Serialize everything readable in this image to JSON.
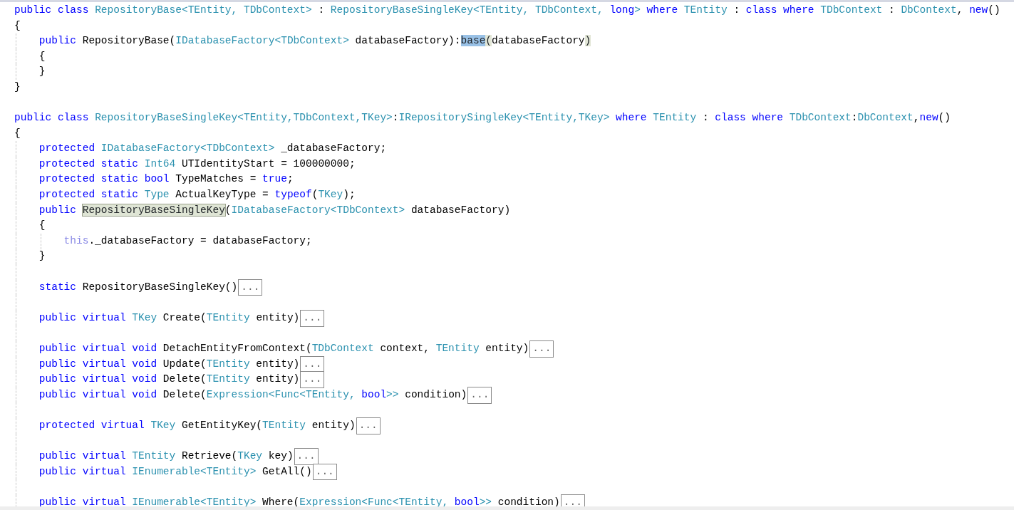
{
  "editor": {
    "lines": [
      {
        "kind": "code",
        "tokens": [
          {
            "text": "public class ",
            "kind": "keyword"
          },
          {
            "text": "RepositoryBase<TEntity, TDbContext>",
            "kind": "type"
          },
          {
            "text": " : ",
            "kind": "plain"
          },
          {
            "text": "RepositoryBaseSingleKey<TEntity, TDbContext, ",
            "kind": "type"
          },
          {
            "text": "long",
            "kind": "keyword"
          },
          {
            "text": ">",
            "kind": "type"
          },
          {
            "text": " where ",
            "kind": "keyword"
          },
          {
            "text": "TEntity",
            "kind": "type"
          },
          {
            "text": " : ",
            "kind": "plain"
          },
          {
            "text": "class where ",
            "kind": "keyword"
          },
          {
            "text": "TDbContext",
            "kind": "type"
          },
          {
            "text": " : ",
            "kind": "plain"
          },
          {
            "text": "DbContext",
            "kind": "type"
          },
          {
            "text": ", ",
            "kind": "plain"
          },
          {
            "text": "new",
            "kind": "keyword"
          },
          {
            "text": "()",
            "kind": "plain"
          }
        ]
      },
      {
        "kind": "code",
        "tokens": [
          {
            "text": "{",
            "kind": "plain"
          }
        ],
        "children": [
          {
            "kind": "code",
            "tokens": [
              {
                "text": "public ",
                "kind": "keyword"
              },
              {
                "text": "RepositoryBase(",
                "kind": "plain"
              },
              {
                "text": "IDatabaseFactory<TDbContext>",
                "kind": "type"
              },
              {
                "text": " databaseFactory):",
                "kind": "plain"
              },
              {
                "text": "base",
                "kind": "selection"
              },
              {
                "text": "(",
                "kind": "brace_match"
              },
              {
                "text": "databaseFactory",
                "kind": "plain"
              },
              {
                "text": ")",
                "kind": "brace_match"
              }
            ]
          },
          {
            "kind": "code",
            "tokens": [
              {
                "text": "{",
                "kind": "plain"
              }
            ]
          },
          {
            "kind": "code",
            "tokens": [
              {
                "text": "}",
                "kind": "plain"
              }
            ]
          }
        ]
      },
      {
        "kind": "code",
        "tokens": [
          {
            "text": "}",
            "kind": "plain"
          }
        ]
      },
      {
        "kind": "blank"
      },
      {
        "kind": "code",
        "tokens": [
          {
            "text": "public class ",
            "kind": "keyword"
          },
          {
            "text": "RepositoryBaseSingleKey<TEntity,TDbContext,TKey>",
            "kind": "type"
          },
          {
            "text": ":",
            "kind": "plain"
          },
          {
            "text": "IRepositorySingleKey<TEntity,TKey>",
            "kind": "type"
          },
          {
            "text": " where ",
            "kind": "keyword"
          },
          {
            "text": "TEntity",
            "kind": "type"
          },
          {
            "text": " : ",
            "kind": "plain"
          },
          {
            "text": "class where ",
            "kind": "keyword"
          },
          {
            "text": "TDbContext",
            "kind": "type"
          },
          {
            "text": ":",
            "kind": "plain"
          },
          {
            "text": "DbContext",
            "kind": "type"
          },
          {
            "text": ",",
            "kind": "plain"
          },
          {
            "text": "new",
            "kind": "keyword"
          },
          {
            "text": "()",
            "kind": "plain"
          }
        ]
      },
      {
        "kind": "code",
        "tokens": [
          {
            "text": "{",
            "kind": "plain"
          }
        ],
        "children": [
          {
            "kind": "code",
            "tokens": [
              {
                "text": "protected ",
                "kind": "keyword"
              },
              {
                "text": "IDatabaseFactory<TDbContext>",
                "kind": "type"
              },
              {
                "text": " _databaseFactory;",
                "kind": "plain"
              }
            ]
          },
          {
            "kind": "code",
            "tokens": [
              {
                "text": "protected static ",
                "kind": "keyword"
              },
              {
                "text": "Int64",
                "kind": "type"
              },
              {
                "text": " UTIdentityStart = 100000000;",
                "kind": "plain"
              }
            ]
          },
          {
            "kind": "code",
            "tokens": [
              {
                "text": "protected static bool",
                "kind": "keyword"
              },
              {
                "text": " TypeMatches = ",
                "kind": "plain"
              },
              {
                "text": "true",
                "kind": "keyword"
              },
              {
                "text": ";",
                "kind": "plain"
              }
            ]
          },
          {
            "kind": "code",
            "tokens": [
              {
                "text": "protected static ",
                "kind": "keyword"
              },
              {
                "text": "Type",
                "kind": "type"
              },
              {
                "text": " ActualKeyType = ",
                "kind": "plain"
              },
              {
                "text": "typeof",
                "kind": "keyword"
              },
              {
                "text": "(",
                "kind": "plain"
              },
              {
                "text": "TKey",
                "kind": "type"
              },
              {
                "text": ");",
                "kind": "plain"
              }
            ]
          },
          {
            "kind": "code",
            "tokens": [
              {
                "text": "public ",
                "kind": "keyword"
              },
              {
                "text": "RepositoryBaseSingleKey",
                "kind": "reference"
              },
              {
                "text": "(",
                "kind": "plain"
              },
              {
                "text": "IDatabaseFactory<TDbContext>",
                "kind": "type"
              },
              {
                "text": " databaseFactory)",
                "kind": "plain"
              }
            ]
          },
          {
            "kind": "code",
            "tokens": [
              {
                "text": "{",
                "kind": "plain"
              }
            ],
            "children": [
              {
                "kind": "code",
                "tokens": [
                  {
                    "text": "this",
                    "kind": "this"
                  },
                  {
                    "text": "._databaseFactory = databaseFactory;",
                    "kind": "plain"
                  }
                ]
              }
            ]
          },
          {
            "kind": "code",
            "tokens": [
              {
                "text": "}",
                "kind": "plain"
              }
            ]
          },
          {
            "kind": "blank"
          },
          {
            "kind": "code",
            "tokens": [
              {
                "text": "static ",
                "kind": "keyword"
              },
              {
                "text": "RepositoryBaseSingleKey()",
                "kind": "plain"
              }
            ],
            "fold": "..."
          },
          {
            "kind": "blank"
          },
          {
            "kind": "code",
            "tokens": [
              {
                "text": "public virtual ",
                "kind": "keyword"
              },
              {
                "text": "TKey",
                "kind": "type"
              },
              {
                "text": " Create(",
                "kind": "plain"
              },
              {
                "text": "TEntity",
                "kind": "type"
              },
              {
                "text": " entity)",
                "kind": "plain"
              }
            ],
            "fold": "..."
          },
          {
            "kind": "blank"
          },
          {
            "kind": "code",
            "tokens": [
              {
                "text": "public virtual void ",
                "kind": "keyword"
              },
              {
                "text": "DetachEntityFromContext(",
                "kind": "plain"
              },
              {
                "text": "TDbContext",
                "kind": "type"
              },
              {
                "text": " context, ",
                "kind": "plain"
              },
              {
                "text": "TEntity",
                "kind": "type"
              },
              {
                "text": " entity)",
                "kind": "plain"
              }
            ],
            "fold": "..."
          },
          {
            "kind": "code",
            "tokens": [
              {
                "text": "public virtual void ",
                "kind": "keyword"
              },
              {
                "text": "Update(",
                "kind": "plain"
              },
              {
                "text": "TEntity",
                "kind": "type"
              },
              {
                "text": " entity)",
                "kind": "plain"
              }
            ],
            "fold": "..."
          },
          {
            "kind": "code",
            "tokens": [
              {
                "text": "public virtual void ",
                "kind": "keyword"
              },
              {
                "text": "Delete(",
                "kind": "plain"
              },
              {
                "text": "TEntity",
                "kind": "type"
              },
              {
                "text": " entity)",
                "kind": "plain"
              }
            ],
            "fold": "..."
          },
          {
            "kind": "code",
            "tokens": [
              {
                "text": "public virtual void ",
                "kind": "keyword"
              },
              {
                "text": "Delete(",
                "kind": "plain"
              },
              {
                "text": "Expression<Func<TEntity, ",
                "kind": "type"
              },
              {
                "text": "bool",
                "kind": "keyword"
              },
              {
                "text": ">>",
                "kind": "type"
              },
              {
                "text": " condition)",
                "kind": "plain"
              }
            ],
            "fold": "..."
          },
          {
            "kind": "blank"
          },
          {
            "kind": "code",
            "tokens": [
              {
                "text": "protected virtual ",
                "kind": "keyword"
              },
              {
                "text": "TKey",
                "kind": "type"
              },
              {
                "text": " GetEntityKey(",
                "kind": "plain"
              },
              {
                "text": "TEntity",
                "kind": "type"
              },
              {
                "text": " entity)",
                "kind": "plain"
              }
            ],
            "fold": "..."
          },
          {
            "kind": "blank"
          },
          {
            "kind": "code",
            "tokens": [
              {
                "text": "public virtual ",
                "kind": "keyword"
              },
              {
                "text": "TEntity",
                "kind": "type"
              },
              {
                "text": " Retrieve(",
                "kind": "plain"
              },
              {
                "text": "TKey",
                "kind": "type"
              },
              {
                "text": " key)",
                "kind": "plain"
              }
            ],
            "fold": "..."
          },
          {
            "kind": "code",
            "tokens": [
              {
                "text": "public virtual ",
                "kind": "keyword"
              },
              {
                "text": "IEnumerable<TEntity>",
                "kind": "type"
              },
              {
                "text": " GetAll()",
                "kind": "plain"
              }
            ],
            "fold": "..."
          },
          {
            "kind": "blank"
          },
          {
            "kind": "code",
            "tokens": [
              {
                "text": "public virtual ",
                "kind": "keyword"
              },
              {
                "text": "IEnumerable<TEntity>",
                "kind": "type"
              },
              {
                "text": " Where(",
                "kind": "plain"
              },
              {
                "text": "Expression<Func<TEntity, ",
                "kind": "type"
              },
              {
                "text": "bool",
                "kind": "keyword"
              },
              {
                "text": ">>",
                "kind": "type"
              },
              {
                "text": " condition)",
                "kind": "plain"
              }
            ],
            "fold": "..."
          }
        ]
      }
    ]
  }
}
